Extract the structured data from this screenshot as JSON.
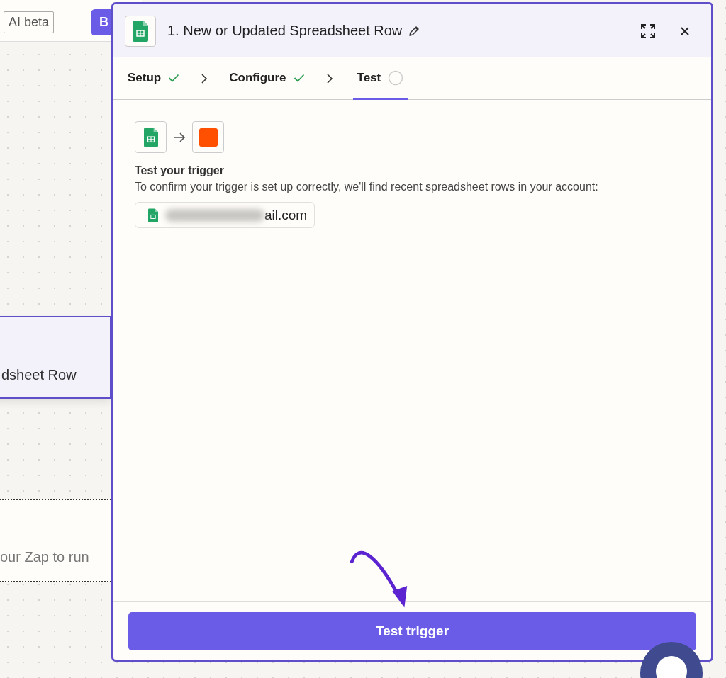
{
  "toolbar": {
    "ai_badge": "AI beta",
    "button": "B"
  },
  "canvas_nodes": [
    {
      "text": "dsheet Row",
      "kind": "trigger"
    },
    {
      "text": "our Zap to run",
      "kind": "placeholder"
    }
  ],
  "panel": {
    "title": "1. New or Updated Spreadsheet Row",
    "steps": [
      {
        "label": "Setup",
        "done": true,
        "selected": false
      },
      {
        "label": "Configure",
        "done": true,
        "selected": false
      },
      {
        "label": "Test",
        "done": false,
        "selected": true
      }
    ],
    "heading": "Test your trigger",
    "description": "To confirm your trigger is set up correctly, we'll find recent spreadsheet rows in your account:",
    "account": "ail.com",
    "button": "Test trigger"
  }
}
